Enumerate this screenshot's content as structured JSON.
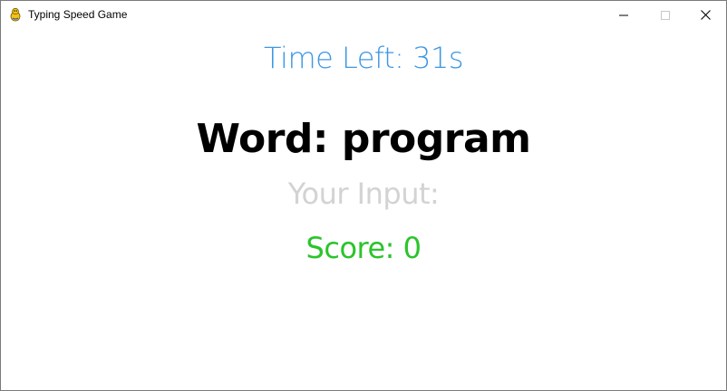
{
  "window": {
    "title": "Typing Speed Game",
    "icon": "pygame-snake-icon",
    "controls": {
      "minimize_icon": "minimize-icon",
      "maximize_icon": "maximize-icon",
      "close_icon": "close-icon"
    }
  },
  "game": {
    "time_left": "Time Left: 31s",
    "word": "Word: program",
    "input": "Your Input: ",
    "score": "Score: 0"
  },
  "colors": {
    "time_left": "#3d97e3",
    "word": "#000000",
    "input": "#d3d3d3",
    "score": "#2bc42b",
    "background": "#ffffff"
  }
}
